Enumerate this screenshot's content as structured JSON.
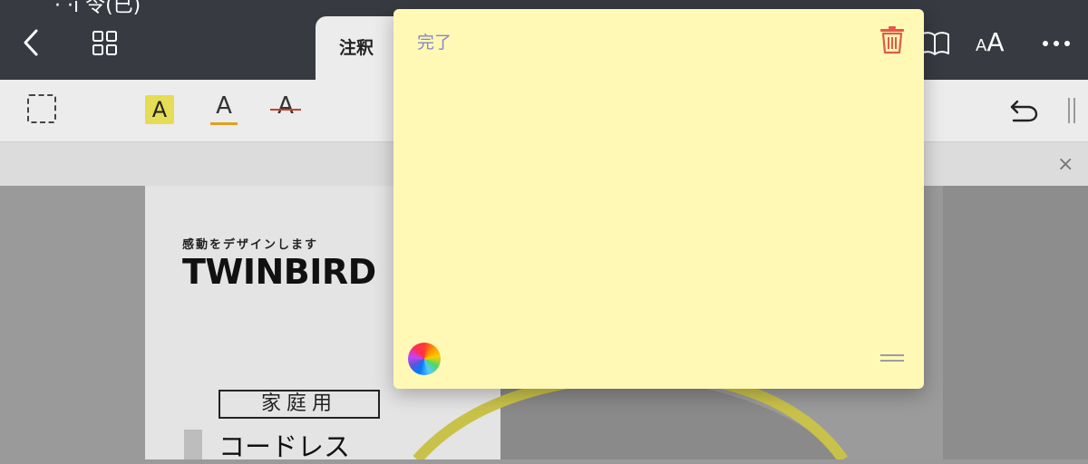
{
  "status": {
    "partial_text": "· ·ı 令(已)"
  },
  "nav": {
    "active_tab": "注釈",
    "font_small": "A",
    "font_large": "A"
  },
  "toolbar": {
    "highlight_glyph": "A",
    "underline_glyph": "A",
    "strike_glyph": "A"
  },
  "strip": {
    "close_glyph": "×"
  },
  "document": {
    "slogan": "感動をデザインします",
    "brand": "TWINBIRD",
    "category": "家庭用",
    "product_text": "コードレス"
  },
  "note": {
    "done_label": "完了",
    "body_text": "",
    "background_color": "#fff9b5",
    "trash_color": "#e5574a"
  },
  "icons": [
    "back-icon",
    "grid-icon",
    "book-icon",
    "more-icon",
    "select-icon",
    "undo-icon",
    "trash-icon",
    "color-wheel-icon",
    "resize-grip-icon"
  ]
}
